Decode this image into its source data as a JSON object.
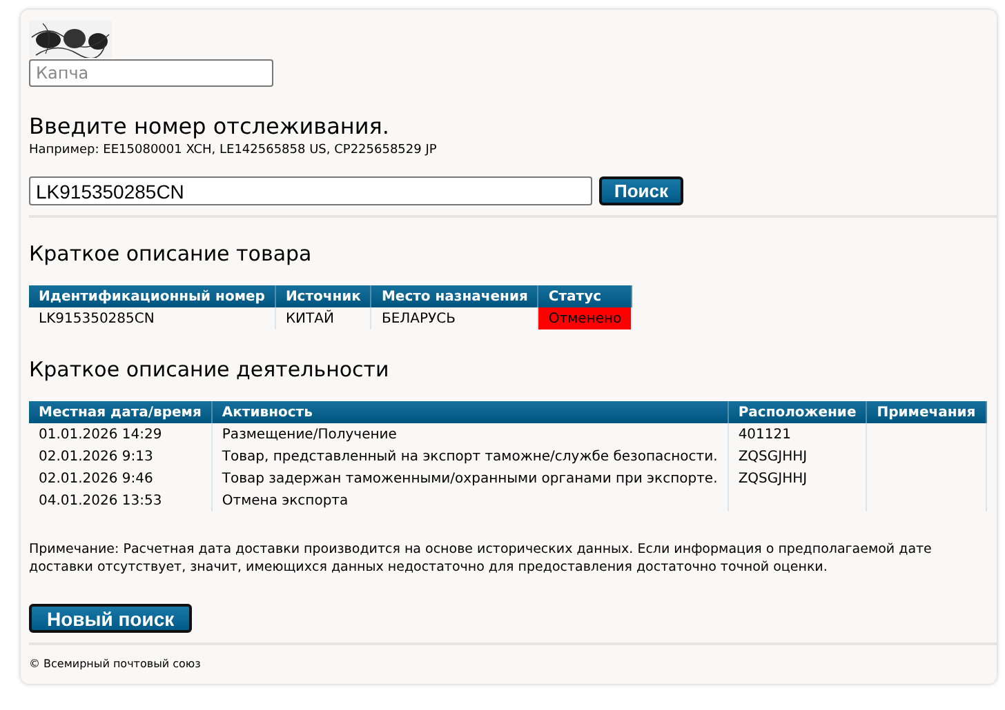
{
  "captcha": {
    "placeholder": "Капча"
  },
  "tracking": {
    "title": "Введите номер отслеживания.",
    "example": "Например: EE15080001 XCH, LE142565858 US, CP225658529 JP",
    "value": "LK915350285CN",
    "search_button": "Поиск"
  },
  "item_summary": {
    "title": "Краткое описание товара",
    "columns": [
      "Идентификационный номер",
      "Источник",
      "Место назначения",
      "Статус"
    ],
    "rows": [
      {
        "id": "LK915350285CN",
        "origin": "КИТАЙ",
        "destination": "БЕЛАРУСЬ",
        "status": {
          "text": "Отменено",
          "color": "#ff0000"
        }
      }
    ]
  },
  "activity": {
    "title": "Краткое описание деятельности",
    "columns": [
      "Местная дата/время",
      "Активность",
      "Расположение",
      "Примечания"
    ],
    "rows": [
      {
        "datetime": "01.01.2026 14:29",
        "activity": "Размещение/Получение",
        "location": "401121"
      },
      {
        "datetime": "02.01.2026 9:13",
        "activity": "Товар, представленный на экспорт таможне/службе безопасности.",
        "location": "ZQSGJHHJ"
      },
      {
        "datetime": "02.01.2026 9:46",
        "activity": "Товар задержан таможенными/охранными органами при экспорте.",
        "location": "ZQSGJHHJ"
      },
      {
        "datetime": "04.01.2026 13:53",
        "activity": "Отмена экспорта"
      }
    ]
  },
  "note": "Примечание: Расчетная дата доставки производится на основе исторических данных. Если информация о предполагаемой дате доставки отсутствует, значит, имеющихся данных недостаточно для предоставления достаточно точной оценки.",
  "new_search_button": "Новый поиск",
  "footer": "© Всемирный почтовый союз"
}
